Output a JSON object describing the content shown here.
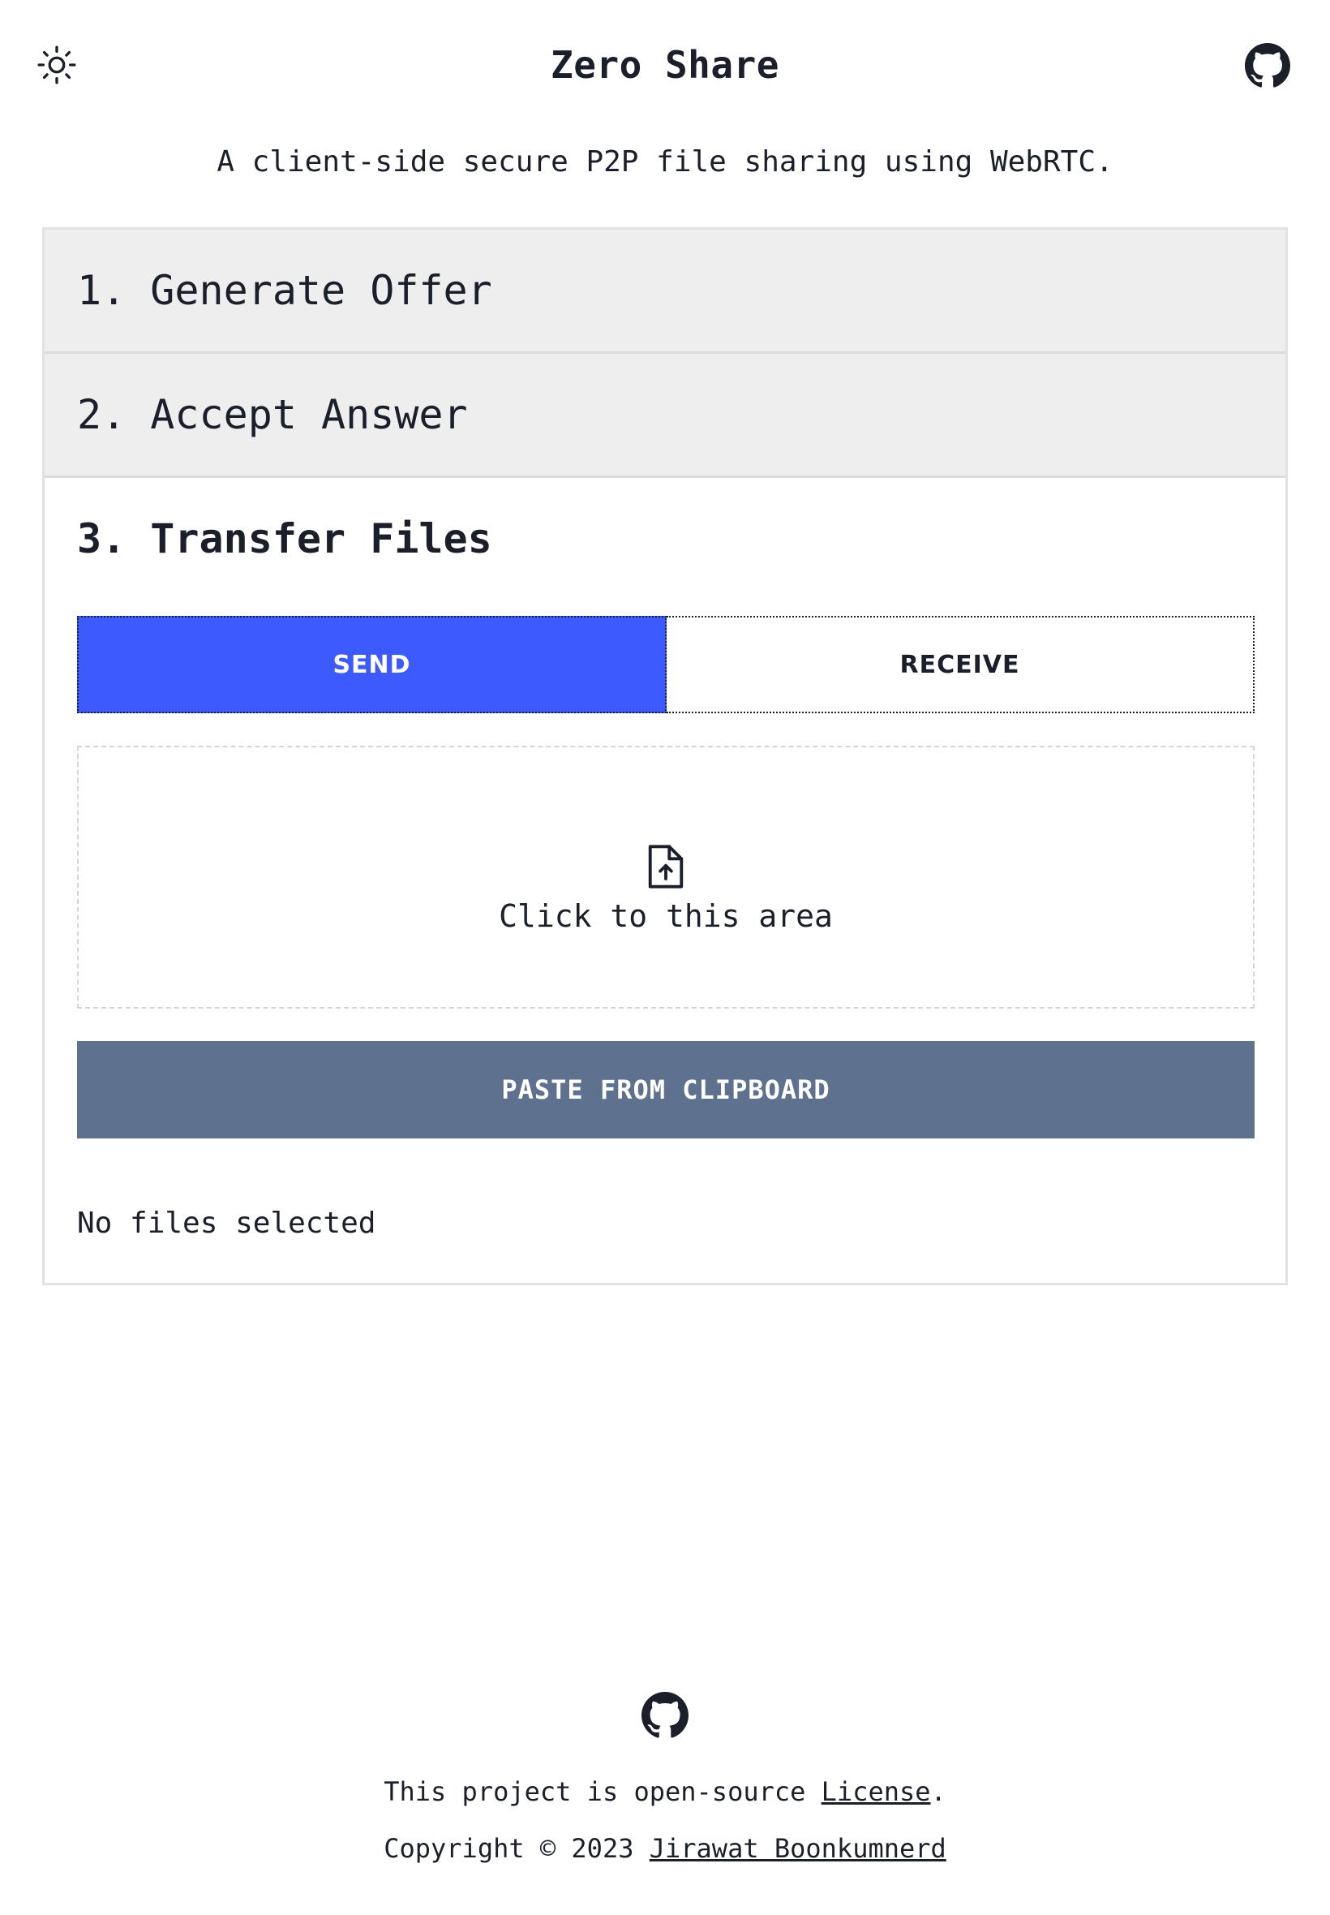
{
  "header": {
    "title": "Zero Share",
    "theme_icon": "sun-icon",
    "github_icon": "github-icon"
  },
  "subtitle": "A client-side secure P2P file sharing using WebRTC.",
  "accordion": {
    "sections": [
      {
        "label": "1. Generate Offer",
        "state": "collapsed"
      },
      {
        "label": "2. Accept Answer",
        "state": "collapsed"
      },
      {
        "label": "3. Transfer Files",
        "state": "open"
      }
    ]
  },
  "transfer": {
    "tabs": [
      {
        "label": "SEND",
        "active": true
      },
      {
        "label": "RECEIVE",
        "active": false
      }
    ],
    "dropzone": {
      "icon": "file-upload-icon",
      "label": "Click to this area"
    },
    "paste_button": "PASTE FROM CLIPBOARD",
    "files_status": "No files selected"
  },
  "footer": {
    "github_icon": "github-icon",
    "license_prefix": "This project is open-source ",
    "license_link": "License",
    "license_suffix": ".",
    "copyright_prefix": "Copyright © 2023 ",
    "author_link": "Jirawat Boonkumnerd"
  },
  "colors": {
    "accent": "#3d5afe",
    "button_gray": "#5e7290",
    "section_bg": "#eeeeee",
    "text": "#1b1f2a"
  }
}
